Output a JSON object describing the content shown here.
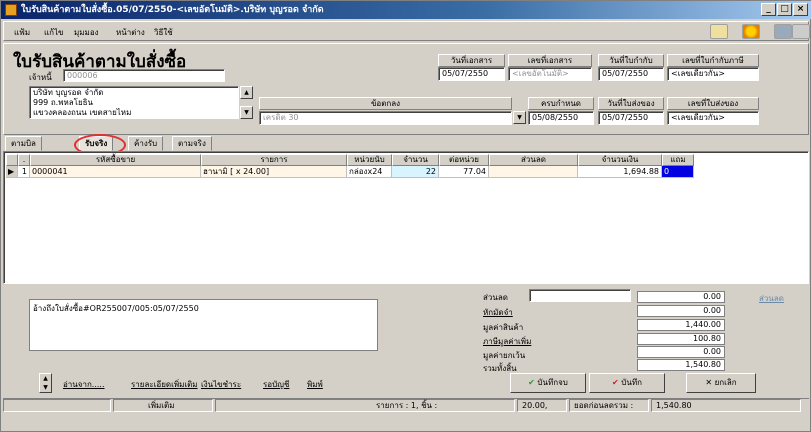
{
  "window": {
    "title": "ใบรับสินค้าตามใบสั่งซื้อ.05/07/2550-<เลขอัตโนมัติ>.บริษัท บุญรอด จำกัด"
  },
  "menu": [
    "แฟ้ม",
    "แก้ไข",
    "มุมมอง",
    "หน้าต่าง",
    "วิธีใช้"
  ],
  "form": {
    "title": "ใบรับสินค้าตามใบสั่งซื้อ",
    "creditor_label": "เจ้าหนี้",
    "creditor_code": "000006",
    "address": [
      "บริษัท บุญรอด จำกัด",
      "999 ถ.พหลโยธิน",
      "แขวงคลองถนน เขตสายไหม"
    ],
    "doc_date_label": "วันที่เอกสาร",
    "doc_date": "05/07/2550",
    "doc_no_label": "เลขที่เอกสาร",
    "doc_no": "<เลขอัตโนมัติ>",
    "invoice_date_label": "วันที่ใบกำกับ",
    "invoice_date": "05/07/2550",
    "tax_invoice_label": "เลขที่ใบกำกับภาษี",
    "tax_invoice_no": "<เลขเดียวกัน>",
    "terms_label": "ข้อตกลง",
    "terms_value": "เครดิต 30",
    "due_label": "ครบกำหนด",
    "due_date": "05/08/2550",
    "delivery_date_label": "วันที่ใบส่งของ",
    "delivery_date": "05/07/2550",
    "delivery_no_label": "เลขที่ใบส่งของ",
    "delivery_no": "<เลขเดียวกัน>"
  },
  "tabs": [
    "ตามบิล",
    "รับจริง",
    "ค้างรับ",
    "ตามจริง"
  ],
  "grid": {
    "headers": [
      "",
      ".",
      "รหัสซื้อขาย",
      "รายการ",
      "หน่วยนับ",
      "จำนวน",
      "ต่อหน่วย",
      "ส่วนลด",
      "จำนวนเงิน",
      "แถม"
    ],
    "rows": [
      {
        "marker": "▶",
        "no": "1",
        "code": "0000041",
        "desc": "ฮานามิ [ x 24.00]",
        "unit": "กล่องx24",
        "qty": "22",
        "price": "77.04",
        "discount": "",
        "amount": "1,694.88",
        "free": "0"
      }
    ]
  },
  "memo": "อ้างถึงใบสั่งซื้อ#OR255007/005:05/07/2550",
  "totals": {
    "discount_label": "ส่วนลด",
    "discount_field": "",
    "discount_value": "0.00",
    "discount_btn": "ส่วนลด",
    "deposit_label": "หักมัดจำ",
    "deposit_value": "0.00",
    "goods_label": "มูลค่าสินค้า",
    "goods_value": "1,440.00",
    "vat_label": "ภาษีมูลค่าเพิ่ม",
    "vat_value": "100.80",
    "exempt_label": "มูลค่ายกเว้น",
    "exempt_value": "0.00",
    "total_label": "รวมทั้งสิ้น",
    "total_value": "1,540.80"
  },
  "links": [
    "อ่านจาก.....",
    "รายละเอียดเพิ่มเติม",
    "เงินไขชำระ",
    "รอบัญชี",
    "พิมพ์"
  ],
  "buttons": {
    "save_new": "บันทึกจบ",
    "save": "บันทึก",
    "cancel": "ยกเลิก"
  },
  "status": {
    "mode": "เพิ่มเติม",
    "summary": "รายการ : 1, ชิ้น :",
    "qty": "20.00,",
    "before_label": "ยอดก่อนลดรวม :",
    "before_value": "1,540.80"
  }
}
